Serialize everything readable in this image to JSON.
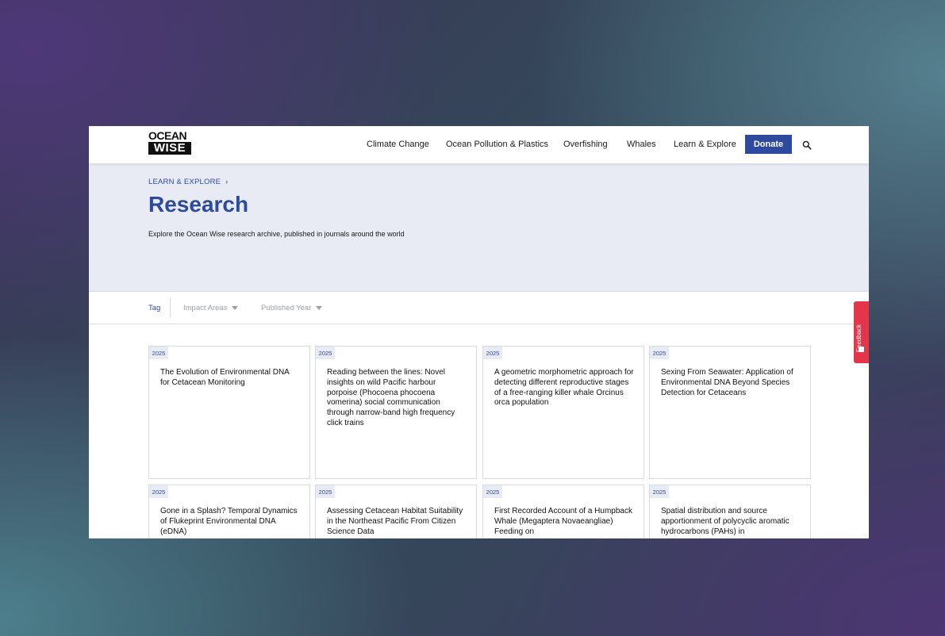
{
  "logo": {
    "line1": "OCEAN",
    "line2": "WISE"
  },
  "nav": {
    "items": [
      "Climate Change",
      "Ocean Pollution & Plastics",
      "Overfishing",
      "Whales",
      "Learn & Explore"
    ],
    "donate": "Donate"
  },
  "hero": {
    "breadcrumb": "LEARN & EXPLORE",
    "title": "Research",
    "subtitle": "Explore the Ocean Wise research archive, published in journals around the world"
  },
  "filters": {
    "tag": "Tag",
    "impact_areas": "Impact Areas",
    "published_year": "Published Year"
  },
  "cards": [
    {
      "year": "2025",
      "title": "The Evolution of Environmental DNA for Cetacean Monitoring"
    },
    {
      "year": "2025",
      "title": "Reading between the lines: Novel insights on wild Pacific harbour porpoise (Phocoena phocoena vomerina) social communication through narrow-band high frequency click trains"
    },
    {
      "year": "2025",
      "title": "A geometric morphometric approach for detecting different reproductive stages of a free-ranging killer whale Orcinus orca population"
    },
    {
      "year": "2025",
      "title": "Sexing From Seawater: Application of Environmental DNA Beyond Species Detection for Cetaceans"
    },
    {
      "year": "2025",
      "title": "Gone in a Splash? Temporal Dynamics of Flukeprint Environmental DNA (eDNA)"
    },
    {
      "year": "2025",
      "title": "Assessing Cetacean Habitat Suitability in the Northeast Pacific From Citizen Science Data"
    },
    {
      "year": "2025",
      "title": "First Recorded Account of a Humpback Whale (Megaptera Novaeangliae) Feeding on"
    },
    {
      "year": "2025",
      "title": "Spatial distribution and source apportionment of polycyclic aromatic hydrocarbons (PAHs) in"
    }
  ],
  "feedback": {
    "label": "Feedback"
  }
}
